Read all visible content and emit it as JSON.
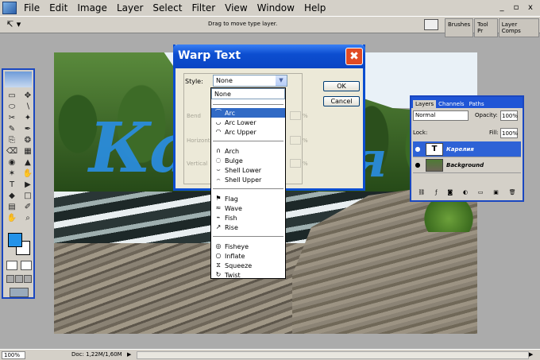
{
  "menubar": {
    "items": [
      "File",
      "Edit",
      "Image",
      "Layer",
      "Select",
      "Filter",
      "View",
      "Window",
      "Help"
    ],
    "window_controls": [
      "_",
      "▫",
      "x"
    ]
  },
  "options_bar": {
    "tool_preset": "↸ ▾",
    "hint": "Drag to move type layer.",
    "palette_well": [
      "Brushes",
      "Tool Pr",
      "Layer Comps"
    ]
  },
  "canvas": {
    "warp_text_left": "Ка",
    "warp_text_right": "я"
  },
  "toolbox": {
    "tools": [
      "▭",
      "✥",
      "⬭",
      "∖",
      "✂",
      "✦",
      "✎",
      "✒",
      "⎘",
      "❂",
      "⌫",
      "▦",
      "◉",
      "▲",
      "✶",
      "✋",
      "T",
      "▶",
      "◆",
      "□",
      "▤",
      "✐",
      "✋",
      "⌕"
    ],
    "fg_color": "#2392e8",
    "bg_color": "#ffffff"
  },
  "layers_panel": {
    "tabs": [
      "Layers",
      "Channels",
      "Paths"
    ],
    "blend_mode": "Normal",
    "opacity_label": "Opacity:",
    "opacity": "100%",
    "lock_label": "Lock:",
    "fill_label": "Fill:",
    "fill": "100%",
    "layers": [
      {
        "name": "Карелия",
        "thumb": "T",
        "selected": true
      },
      {
        "name": "Background",
        "thumb": "",
        "selected": false
      }
    ],
    "footer_icons": [
      "link-icon",
      "style-icon",
      "mask-icon",
      "adjust-icon",
      "folder-icon",
      "new-layer-icon",
      "trash-icon"
    ]
  },
  "warp_dialog": {
    "title": "Warp Text",
    "close": "✖",
    "style_label": "Style:",
    "style_value": "None",
    "bend_label": "Bend",
    "horizontal_label": "Horizontal",
    "vertical_label": "Vertical",
    "pct": "%",
    "ok_label": "OK",
    "cancel_label": "Cancel"
  },
  "style_dropdown": {
    "current": "None",
    "groups": [
      [
        {
          "label": "Arc",
          "icon": "⌒",
          "selected": true
        },
        {
          "label": "Arc Lower",
          "icon": "◡"
        },
        {
          "label": "Arc Upper",
          "icon": "◠"
        }
      ],
      [
        {
          "label": "Arch",
          "icon": "∩"
        },
        {
          "label": "Bulge",
          "icon": "◌"
        },
        {
          "label": "Shell Lower",
          "icon": "⌣"
        },
        {
          "label": "Shell Upper",
          "icon": "⌢"
        }
      ],
      [
        {
          "label": "Flag",
          "icon": "⚑"
        },
        {
          "label": "Wave",
          "icon": "≈"
        },
        {
          "label": "Fish",
          "icon": "⌁"
        },
        {
          "label": "Rise",
          "icon": "↗"
        }
      ],
      [
        {
          "label": "Fisheye",
          "icon": "◎"
        },
        {
          "label": "Inflate",
          "icon": "○"
        },
        {
          "label": "Squeeze",
          "icon": "⧖"
        },
        {
          "label": "Twist",
          "icon": "↻"
        }
      ]
    ]
  },
  "status_bar": {
    "zoom": "100%",
    "doc": "Doc: 1,22M/1,60M",
    "arrow": "▶"
  }
}
